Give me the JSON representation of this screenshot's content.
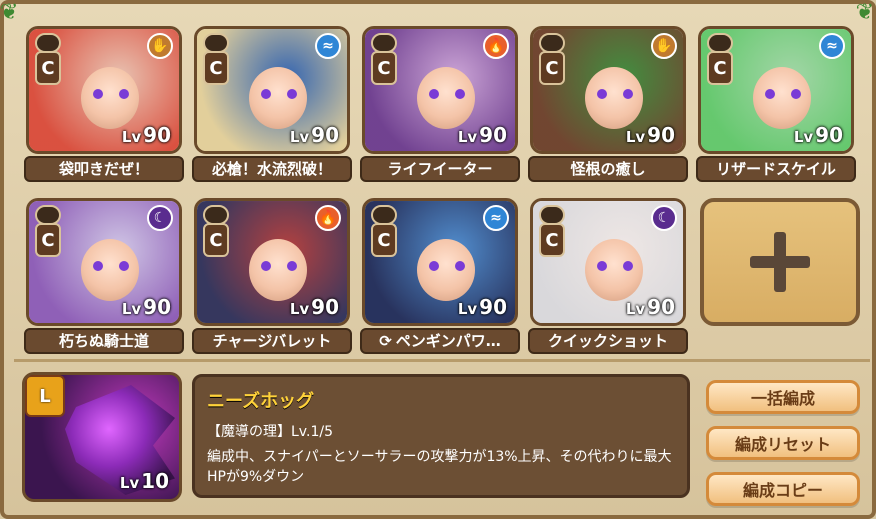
{
  "colors": {
    "fire": "#e8602b",
    "water": "#2f86d6",
    "dark": "#5a2c8f",
    "earth": "#c07a2f",
    "gold_text": "#ffd23a"
  },
  "characters": [
    {
      "rank": "C",
      "level": "90",
      "skill": "袋叩きだぜ！",
      "element": "earth",
      "hair": "#d94a3a",
      "bg": "#e9c2b2"
    },
    {
      "rank": "C",
      "level": "90",
      "skill": "必槍！水流烈破！",
      "element": "water",
      "hair": "#e2cf9a",
      "bg": "#2b5fb0"
    },
    {
      "rank": "C",
      "level": "90",
      "skill": "ライフイーター",
      "element": "fire",
      "hair": "#6b3a8f",
      "bg": "#caa2d8"
    },
    {
      "rank": "C",
      "level": "90",
      "skill": "怪根の癒し",
      "element": "earth",
      "hair": "#6b3f2a",
      "bg": "#3a8a3a"
    },
    {
      "rank": "C",
      "level": "90",
      "skill": "リザードスケイル",
      "element": "water",
      "hair": "#5fc86b",
      "bg": "#9fd6a6"
    },
    {
      "rank": "C",
      "level": "90",
      "skill": "朽ちぬ騎士道",
      "element": "dark",
      "hair": "#8b5ab8",
      "bg": "#cfc5e8"
    },
    {
      "rank": "C",
      "level": "90",
      "skill": "チャージバレット",
      "element": "fire",
      "hair": "#2d2f5a",
      "bg": "#b23a3a"
    },
    {
      "rank": "C",
      "level": "90",
      "skill": "ペンギンパワ…",
      "element": "water",
      "hair": "#1f2b5a",
      "bg": "#4a8ad0",
      "skill_icon": true
    },
    {
      "rank": "C",
      "level": "90",
      "skill": "クイックショット",
      "element": "dark",
      "hair": "#d9d9de",
      "bg": "#efe8e8"
    }
  ],
  "leader": {
    "rank": "L",
    "level_prefix": "Lv",
    "level": "10",
    "name": "ニーズホッグ",
    "skill_title": "【魔導の理】Lv.1/5",
    "skill_desc": "編成中、スナイパーとソーサラーの攻撃力が13%上昇、その代わりに最大HPが9%ダウン"
  },
  "buttons": {
    "bulk": "一括編成",
    "reset": "編成リセット",
    "copy": "編成コピー"
  },
  "ui": {
    "level_prefix": "Lv"
  }
}
